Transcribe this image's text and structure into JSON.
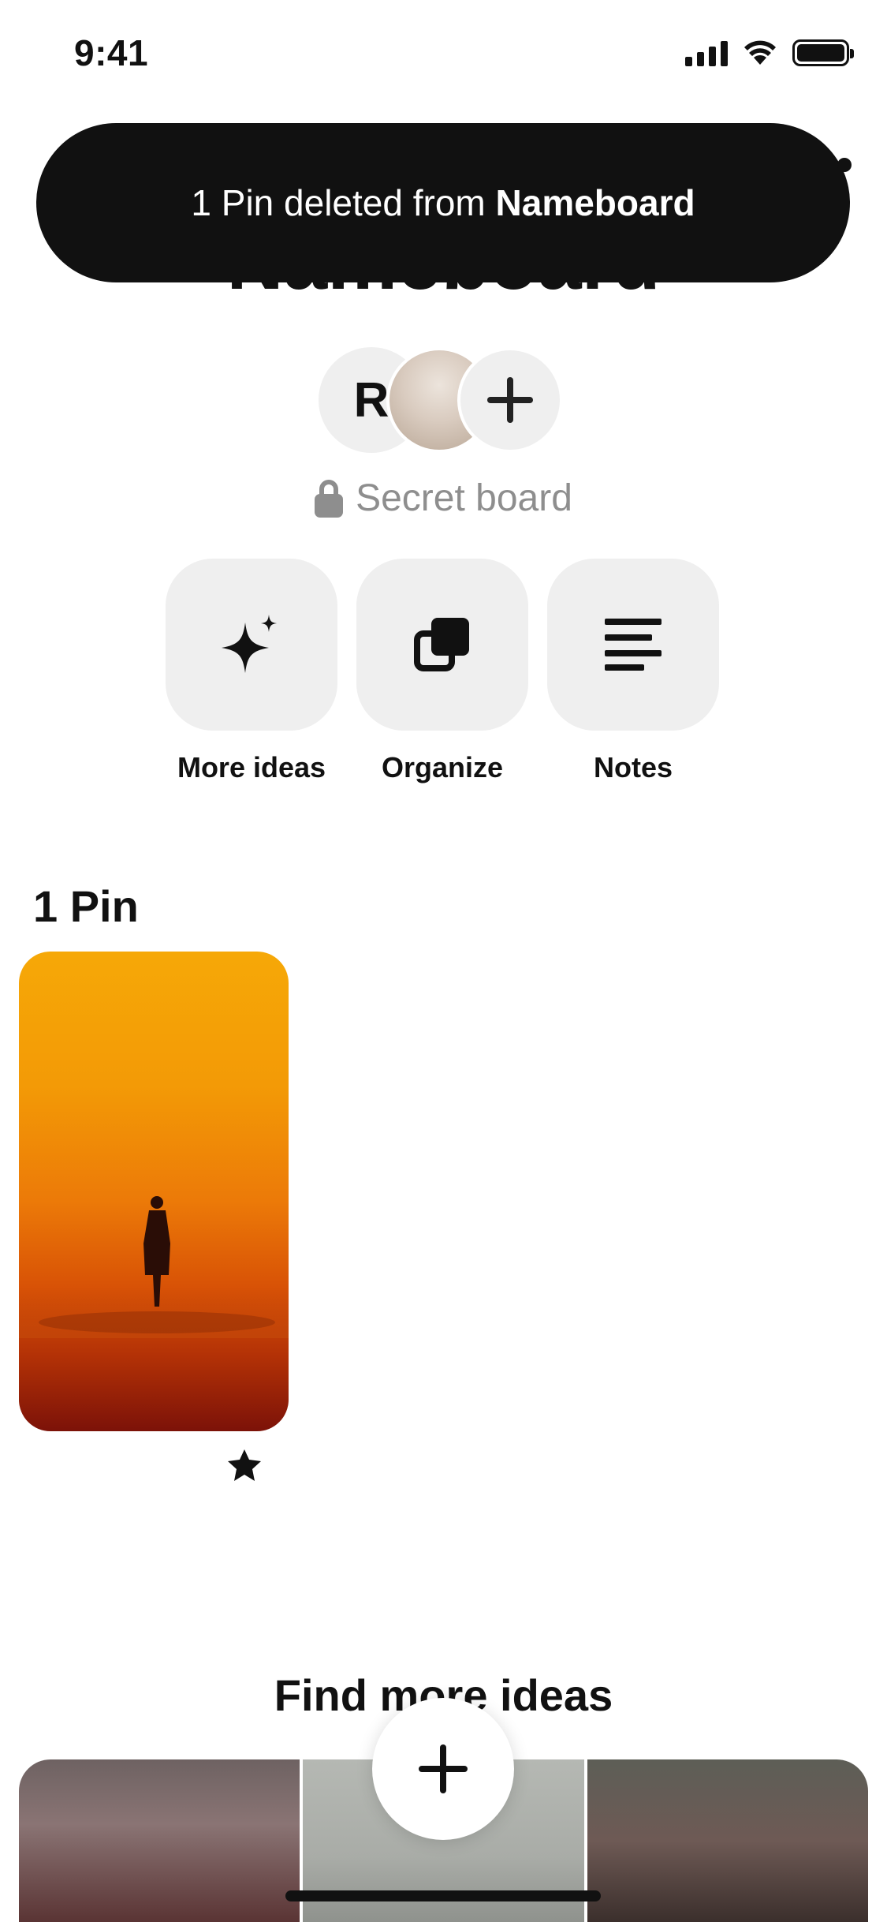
{
  "status_bar": {
    "time": "9:41"
  },
  "board": {
    "title": "Nameboard",
    "collaborator_initial": "R",
    "privacy_label": "Secret board"
  },
  "toast": {
    "prefix": "1 Pin deleted from ",
    "board_name": "Nameboard"
  },
  "actions": [
    {
      "label": "More ideas",
      "icon": "sparkle-icon"
    },
    {
      "label": "Organize",
      "icon": "organize-icon"
    },
    {
      "label": "Notes",
      "icon": "notes-icon"
    }
  ],
  "pins": {
    "count_label": "1 Pin"
  },
  "find_more": {
    "title": "Find more ideas"
  }
}
